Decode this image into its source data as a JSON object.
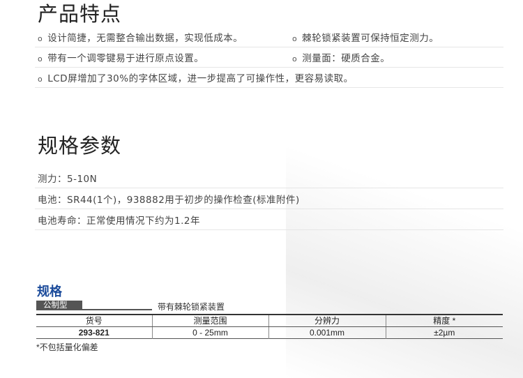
{
  "features": {
    "title": "产品特点",
    "rows": [
      [
        "设计简捷，无需整合输出数据，实现低成本。",
        "棘轮锁紧装置可保持恒定测力。"
      ],
      [
        "带有一个调零键易于进行原点设置。",
        "测量面：硬质合金。"
      ],
      [
        "LCD屏增加了30%的字体区域，进一步提高了可操作性，更容易读取。"
      ]
    ]
  },
  "specs": {
    "title": "规格参数",
    "items": [
      "测力：5-10N",
      "电池：SR44(1个)，938882用于初步的操作检查(标准附件)",
      "电池寿命：正常使用情况下约为1.2年"
    ]
  },
  "table": {
    "title": "规格",
    "tag": "公制型",
    "note": "带有棘轮锁紧装置",
    "headers": [
      "货号",
      "测量范围",
      "分辨力",
      "精度 *"
    ],
    "rows": [
      [
        "293-821",
        "0 - 25mm",
        "0.001mm",
        "±2µm"
      ]
    ],
    "footnote": "*不包括量化偏差"
  },
  "colors": {
    "accent": "#1a4a9a",
    "tag_bg": "#555555"
  }
}
